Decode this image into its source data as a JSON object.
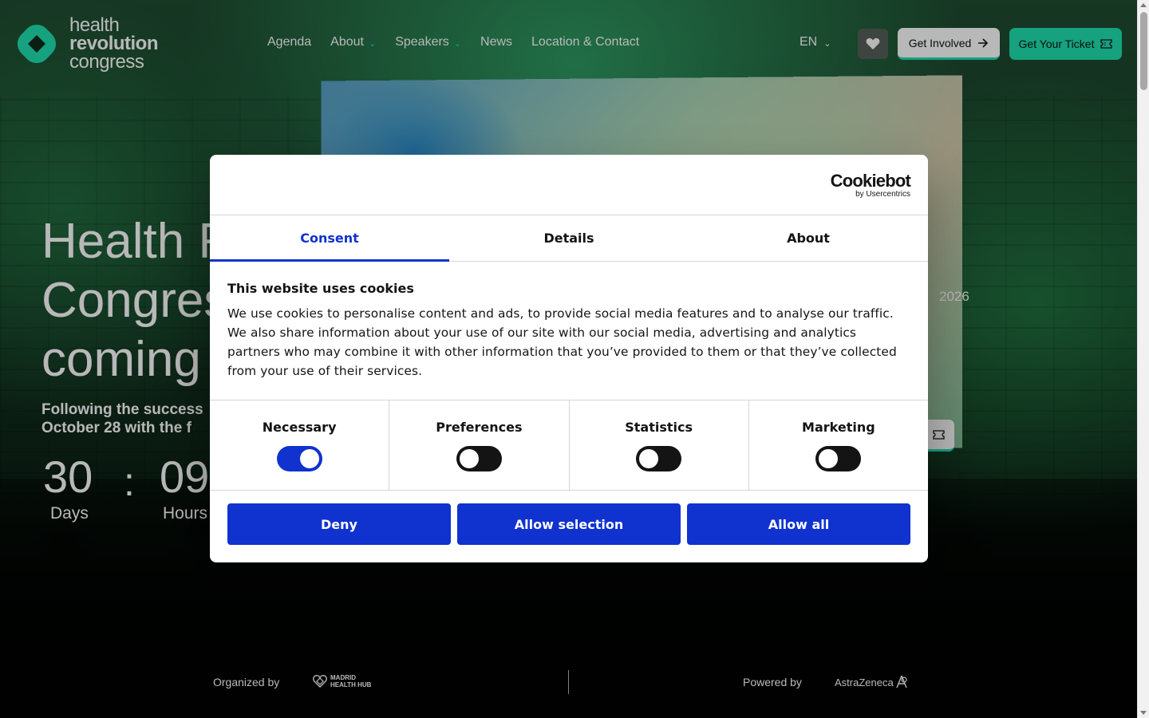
{
  "site": {
    "logo_lines": [
      "health",
      "revolution",
      "congress"
    ],
    "nav": [
      {
        "label": "Agenda",
        "dropdown": false
      },
      {
        "label": "About",
        "dropdown": true
      },
      {
        "label": "Speakers",
        "dropdown": true
      },
      {
        "label": "News",
        "dropdown": false
      },
      {
        "label": "Location & Contact",
        "dropdown": false
      }
    ],
    "language": "EN",
    "get_involved_label": "Get Involved",
    "get_ticket_label": "Get Your Ticket",
    "accent_color": "#1fe0b0"
  },
  "hero": {
    "title_lines": [
      "Health Revolution",
      "Congress is",
      "coming"
    ],
    "subtitle_lines": [
      "Following the success",
      "October 28 with the f"
    ],
    "year_fragment": "2026",
    "countdown": {
      "days_value": "30",
      "days_label": "Days",
      "separator": ":",
      "hours_value": "09",
      "hours_label": "Hours"
    }
  },
  "footer_strip": {
    "organized_by_label": "Organized by",
    "organizer_logo_lines": [
      "MADRID",
      "HEALTH HUB"
    ],
    "powered_by_label": "Powered by",
    "sponsor_logo_text": "AstraZeneca"
  },
  "cookie_dialog": {
    "brand": "Cookiebot",
    "brand_sub": "by Usercentrics",
    "tabs": [
      "Consent",
      "Details",
      "About"
    ],
    "active_tab": "Consent",
    "heading": "This website uses cookies",
    "body": "We use cookies to personalise content and ads, to provide social media features and to analyse our traffic. We also share information about your use of our site with our social media, advertising and analytics partners who may combine it with other information that you’ve provided to them or that they’ve collected from your use of their services.",
    "toggles": [
      {
        "label": "Necessary",
        "on": true
      },
      {
        "label": "Preferences",
        "on": false
      },
      {
        "label": "Statistics",
        "on": false
      },
      {
        "label": "Marketing",
        "on": false
      }
    ],
    "buttons": {
      "deny": "Deny",
      "allow_selection": "Allow selection",
      "allow_all": "Allow all"
    },
    "accent_color": "#1032cf"
  }
}
